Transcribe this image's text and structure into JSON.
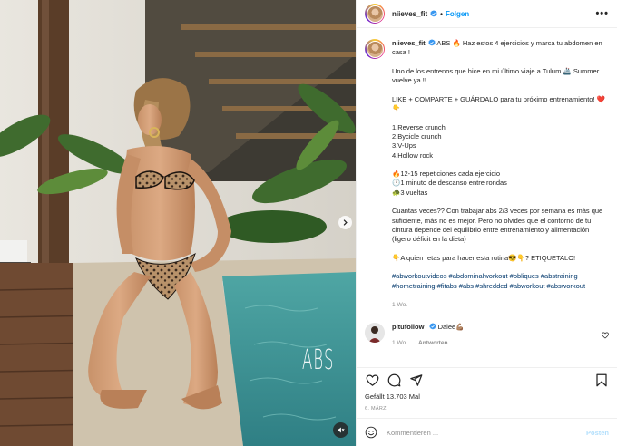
{
  "post": {
    "username": "niieves_fit",
    "follow_label": "Folgen",
    "more_label": "•••",
    "video_overlay_text": "ABS"
  },
  "caption": {
    "username": "niieves_fit",
    "paragraphs": [
      "ABS 🔥 Haz estos 4 ejercicios y marca tu abdomen en casa !",
      "Uno de los entrenos que hice en mi último viaje a Tulum 🚢 Summer vuelve ya !!",
      "LIKE + COMPARTE + GUÁRDALO para tu próximo entrenamiento! ❤️👇",
      "1.Reverse crunch\n2.Bycicle crunch\n3.V-Ups\n4.Hollow rock",
      "🔥12-15 repeticiones cada ejercicio\n🕐1 minuto de descanso entre rondas\n🐢3 vueltas",
      "Cuantas veces?? Con trabajar abs 2/3 veces por semana es más que suficiente, más no es mejor. Pero no olvides que el contorno de tu cintura depende del equilibrio entre entrenamiento y alimentación (ligero déficit en la dieta)",
      "👇A quien retas para hacer esta rutina😎👇? ETIQUETALO!"
    ],
    "hashtags": "#abworkoutvideos #abdominalworkout #obliques #abstraining #hometraining #fitabs #abs #shredded #abworkout #absworkout",
    "time_ago": "1 Wo."
  },
  "comments": [
    {
      "username": "pitufollow",
      "text": "Dalee💪🏽",
      "time_ago": "1 Wo.",
      "reply_label": "Antworten"
    }
  ],
  "stats": {
    "likes_text": "Gefällt 13.703 Mal",
    "date_text": "6. MÄRZ"
  },
  "composer": {
    "placeholder": "Kommentieren ...",
    "post_label": "Posten"
  },
  "colors": {
    "accent": "#0095f6",
    "hashtag": "#00376b",
    "muted": "#8e8e8e",
    "verified": "#3897f0"
  }
}
